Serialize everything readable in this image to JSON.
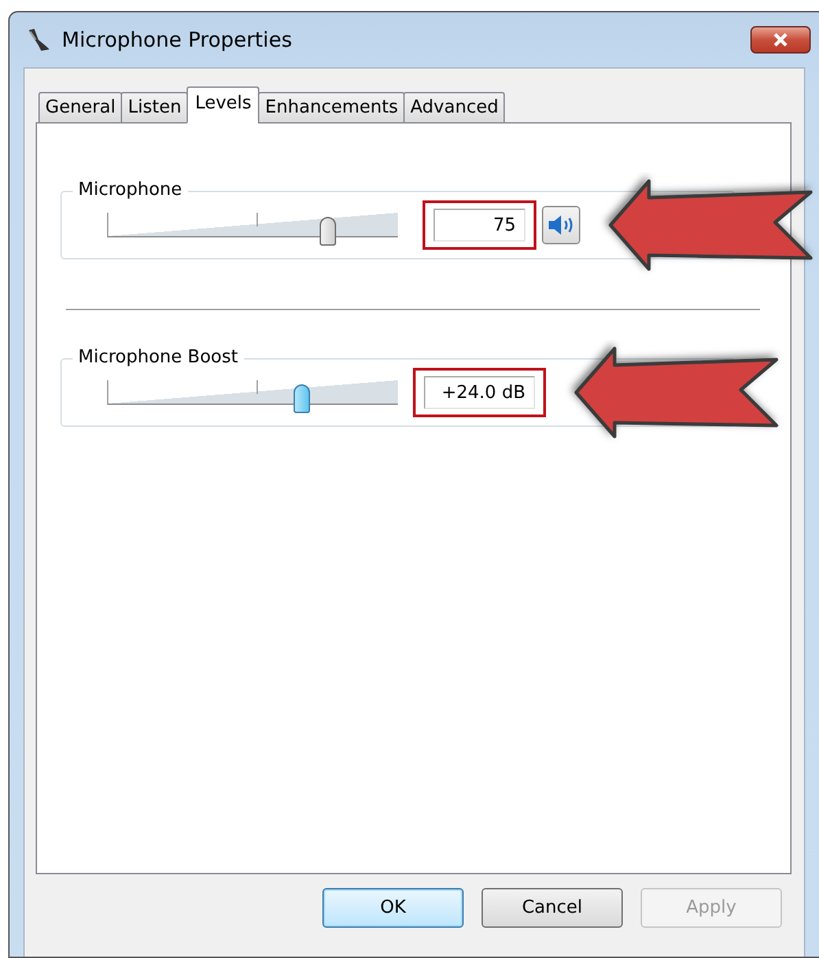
{
  "window": {
    "title": "Microphone Properties"
  },
  "tabs": [
    {
      "label": "General",
      "selected": false
    },
    {
      "label": "Listen",
      "selected": false
    },
    {
      "label": "Levels",
      "selected": true
    },
    {
      "label": "Enhancements",
      "selected": false
    },
    {
      "label": "Advanced",
      "selected": false
    }
  ],
  "levels": [
    {
      "name": "Microphone",
      "level": 0.76,
      "focused": false,
      "value": "75",
      "highlighted": true,
      "mute_button": true,
      "arrow": true
    },
    {
      "name": "Microphone Boost",
      "level": 0.67,
      "focused": true,
      "value": "+24.0 dB",
      "highlighted": true,
      "mute_button": false,
      "arrow": true
    }
  ],
  "buttons": [
    {
      "label": "OK",
      "default": true,
      "disabled": false
    },
    {
      "label": "Cancel",
      "default": false,
      "disabled": false
    },
    {
      "label": "Apply",
      "default": false,
      "disabled": true
    }
  ]
}
